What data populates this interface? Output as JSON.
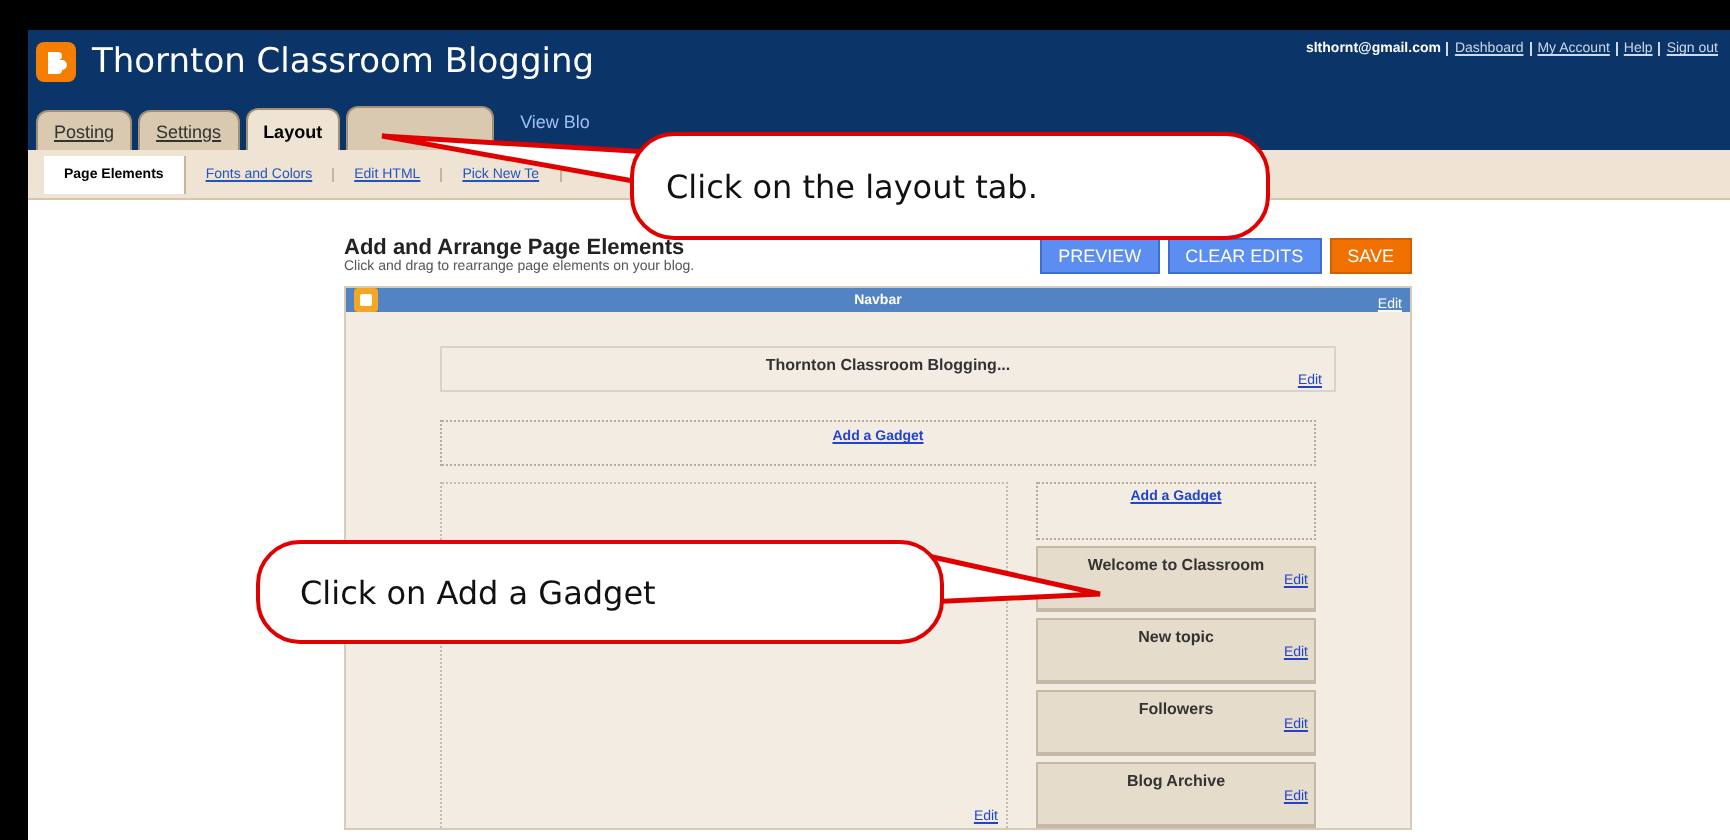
{
  "header": {
    "title": "Thornton Classroom Blogging",
    "email": "slthornt@gmail.com",
    "links": [
      "Dashboard",
      "My Account",
      "Help",
      "Sign out"
    ]
  },
  "tabs": [
    {
      "label": "Posting",
      "selected": false
    },
    {
      "label": "Settings",
      "selected": false
    },
    {
      "label": "Layout",
      "selected": true
    }
  ],
  "view_blog_link": "View Blo",
  "subtabs": [
    {
      "label": "Page Elements",
      "selected": true
    },
    {
      "label": "Fonts and Colors",
      "selected": false
    },
    {
      "label": "Edit HTML",
      "selected": false
    },
    {
      "label": "Pick New Te",
      "selected": false
    }
  ],
  "page": {
    "heading": "Add and Arrange Page Elements",
    "subheading": "Click and drag to rearrange page elements on your blog.",
    "buttons": [
      {
        "label": "PREVIEW",
        "kind": "secondary"
      },
      {
        "label": "CLEAR EDITS",
        "kind": "secondary"
      },
      {
        "label": "SAVE",
        "kind": "primary"
      }
    ]
  },
  "layout": {
    "navbar": {
      "title": "Navbar",
      "edit": "Edit"
    },
    "header_widget": {
      "title": "Thornton Classroom Blogging...",
      "edit": "Edit"
    },
    "add_gadget_wide": "Add a Gadget",
    "main_edit": "Edit",
    "sidebar_add_gadget": "Add a Gadget",
    "sidebar_widgets": [
      {
        "title": "Welcome to Classroom",
        "edit": "Edit"
      },
      {
        "title": "New topic",
        "edit": "Edit"
      },
      {
        "title": "Followers",
        "edit": "Edit"
      },
      {
        "title": "Blog Archive",
        "edit": "Edit"
      }
    ]
  },
  "callouts": [
    {
      "text": "Click on the layout tab."
    },
    {
      "text": "Click on Add a Gadget"
    }
  ]
}
